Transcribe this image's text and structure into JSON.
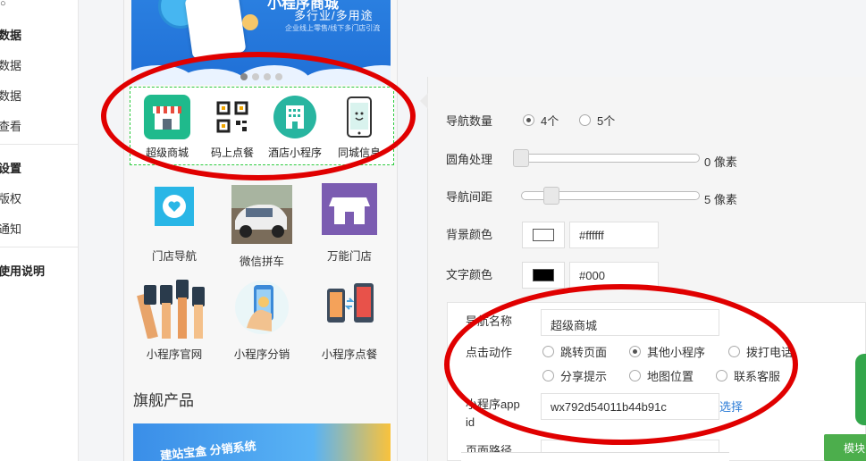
{
  "sidebar": {
    "items": [
      {
        "label": "数据",
        "bold": true
      },
      {
        "label": "数据",
        "bold": false
      },
      {
        "label": "数据",
        "bold": false
      },
      {
        "label": "查看",
        "bold": false
      },
      {
        "label": "设置",
        "bold": true
      },
      {
        "label": "版权",
        "bold": false
      },
      {
        "label": "通知",
        "bold": false
      },
      {
        "label": "使用说明",
        "bold": true
      }
    ]
  },
  "phone": {
    "banner": {
      "title": "小程序商城",
      "subtitle": "多行业/多用途",
      "caption": "企业线上零售/线下多门店引流"
    },
    "nav_items": [
      {
        "label": "超级商城",
        "icon": "store-icon"
      },
      {
        "label": "码上点餐",
        "icon": "qrcode-icon"
      },
      {
        "label": "酒店小程序",
        "icon": "hotel-icon"
      },
      {
        "label": "同城信息",
        "icon": "smartphone-icon"
      }
    ],
    "grid": [
      {
        "label": "门店导航",
        "icon": "heart-bubble-icon"
      },
      {
        "label": "微信拼车",
        "icon": "car-icon"
      },
      {
        "label": "万能门店",
        "icon": "shop-icon"
      },
      {
        "label": "小程序官网",
        "icon": "hands-phones-icon"
      },
      {
        "label": "小程序分销",
        "icon": "hand-phone-icon"
      },
      {
        "label": "小程序点餐",
        "icon": "phones-icon"
      }
    ],
    "section_title": "旗舰产品",
    "banner2_text": "建站宝盒 分销系统"
  },
  "settings": {
    "nav_count": {
      "label": "导航数量",
      "options": [
        "4个",
        "5个"
      ],
      "selected": "4个"
    },
    "radius": {
      "label": "圆角处理",
      "value": "0 像素"
    },
    "spacing": {
      "label": "导航间距",
      "value": "5 像素"
    },
    "bg_color": {
      "label": "背景颜色",
      "value": "#ffffff",
      "color": "#ffffff"
    },
    "text_color": {
      "label": "文字颜色",
      "value": "#000",
      "color": "#000000"
    },
    "nav_name": {
      "label": "导航名称",
      "value": "超级商城"
    },
    "click_action": {
      "label": "点击动作",
      "options": [
        "跳转页面",
        "其他小程序",
        "拨打电话",
        "分享提示",
        "地图位置",
        "联系客服"
      ],
      "selected": "其他小程序"
    },
    "appid": {
      "label": "小程序app id",
      "value": "wx792d54011b44b91c",
      "select_label": "选择"
    },
    "page_path": {
      "label": "页面路径"
    },
    "module_button": "模块"
  },
  "colors": {
    "accent": "#2b7bd6",
    "highlight_dashed": "#2ecc40",
    "annotation": "#e00000",
    "green_button": "#4cae4c"
  }
}
